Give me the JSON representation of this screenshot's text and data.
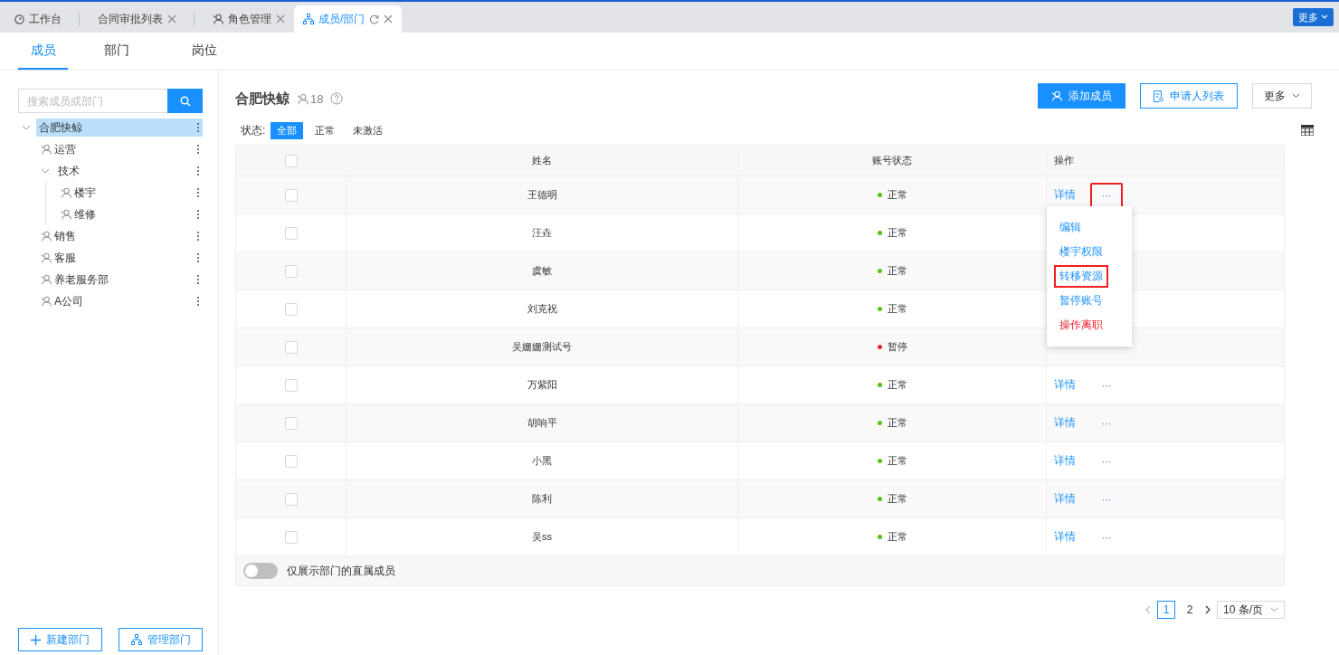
{
  "top_tabs": [
    {
      "label": "工作台",
      "kind": "dashboard",
      "selected": false,
      "closable": false
    },
    {
      "label": "合同审批列表",
      "kind": "plain",
      "selected": false,
      "closable": true
    },
    {
      "label": "角色管理",
      "kind": "user",
      "selected": false,
      "closable": true
    },
    {
      "label": "成员/部门",
      "kind": "org",
      "selected": true,
      "closable": true,
      "refresh": true
    }
  ],
  "top_more": "更多",
  "sub_tabs": [
    {
      "label": "成员",
      "selected": true
    },
    {
      "label": "部门",
      "selected": false
    },
    {
      "label": "岗位",
      "selected": false
    }
  ],
  "sidebar": {
    "search": {
      "placeholder": "搜索成员或部门"
    },
    "tree": [
      {
        "label": "合肥快鲸",
        "selected": true,
        "expanded": true,
        "children": [
          {
            "label": "运营",
            "selected": false
          },
          {
            "label": "技术",
            "selected": false,
            "expanded": true,
            "children": [
              {
                "label": "楼宇",
                "selected": false
              },
              {
                "label": "维修",
                "selected": false
              }
            ]
          },
          {
            "label": "销售",
            "selected": false
          },
          {
            "label": "客服",
            "selected": false
          },
          {
            "label": "养老服务部",
            "selected": false
          },
          {
            "label": "A公司",
            "selected": false
          }
        ]
      }
    ],
    "buttons": [
      {
        "label": "新建部门",
        "kind": "plus"
      },
      {
        "label": "管理部门",
        "kind": "org"
      }
    ]
  },
  "header": {
    "title": "合肥快鲸",
    "count": "18"
  },
  "actions": [
    {
      "label": "添加成员",
      "kind": "primary"
    },
    {
      "label": "申请人列表",
      "kind": "outline"
    },
    {
      "label": "更多",
      "kind": "dropdown"
    }
  ],
  "filter": {
    "label": "状态:",
    "options": [
      {
        "label": "全部",
        "selected": true
      },
      {
        "label": "正常",
        "selected": false
      },
      {
        "label": "未激活",
        "selected": false
      }
    ]
  },
  "table": {
    "all_checked": false,
    "columns": [
      "姓名",
      "账号状态",
      "操作"
    ],
    "rows": [
      {
        "name": "王德明",
        "status": "正常",
        "color": "#52c41a",
        "checked": false,
        "detail": "详情",
        "more": "···",
        "highlighted": true
      },
      {
        "name": "汪垚",
        "status": "正常",
        "color": "#52c41a",
        "checked": false
      },
      {
        "name": "虞敏",
        "status": "正常",
        "color": "#52c41a",
        "checked": false
      },
      {
        "name": "刘克祝",
        "status": "正常",
        "color": "#52c41a",
        "checked": false
      },
      {
        "name": "吴姗姗测试号",
        "status": "暂停",
        "color": "#f5222d",
        "checked": false
      },
      {
        "name": "万紫阳",
        "status": "正常",
        "color": "#52c41a",
        "checked": false,
        "detail": "详情",
        "more": "···",
        "highlighted": false
      },
      {
        "name": "胡响平",
        "status": "正常",
        "color": "#52c41a",
        "checked": false,
        "detail": "详情",
        "more": "···",
        "highlighted": false
      },
      {
        "name": "小黑",
        "status": "正常",
        "color": "#52c41a",
        "checked": false,
        "detail": "详情",
        "more": "···",
        "highlighted": false
      },
      {
        "name": "陈利",
        "status": "正常",
        "color": "#52c41a",
        "checked": false,
        "detail": "详情",
        "more": "···",
        "highlighted": false
      },
      {
        "name": "吴ss",
        "status": "正常",
        "color": "#52c41a",
        "checked": false,
        "detail": "详情",
        "more": "···",
        "highlighted": false
      }
    ]
  },
  "row_menu": {
    "items": [
      {
        "label": "编辑",
        "kind": "normal",
        "highlighted": false
      },
      {
        "label": "楼宇权限",
        "kind": "normal",
        "highlighted": false
      },
      {
        "label": "转移资源",
        "kind": "normal",
        "highlighted": true
      },
      {
        "label": "暂停账号",
        "kind": "normal",
        "highlighted": false
      },
      {
        "label": "操作离职",
        "kind": "danger",
        "highlighted": false
      }
    ]
  },
  "direct_toggle": {
    "label": "仅展示部门的直属成员",
    "on": false
  },
  "pagination": {
    "pages": [
      {
        "label": "1",
        "selected": true
      },
      {
        "label": "2",
        "selected": false
      }
    ],
    "page_size": "10 条/页"
  }
}
